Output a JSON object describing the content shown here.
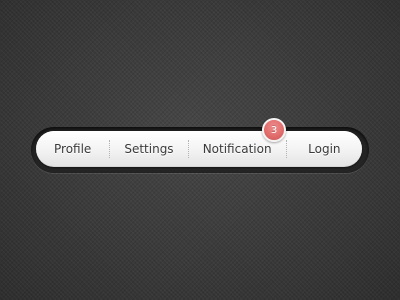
{
  "nav": {
    "items": [
      {
        "label": "Profile"
      },
      {
        "label": "Settings"
      },
      {
        "label": "Notification"
      },
      {
        "label": "Login"
      }
    ],
    "notification_badge": "3"
  },
  "colors": {
    "background": "#3a3a3a",
    "bar": "#f4f4f4",
    "text": "#3b3b3b",
    "badge": "#e06a6a"
  }
}
